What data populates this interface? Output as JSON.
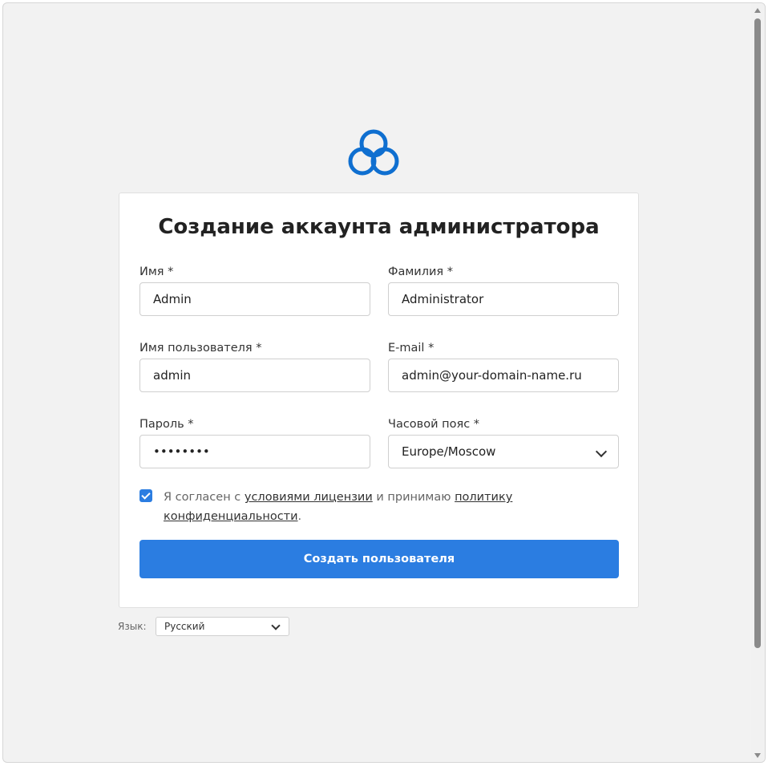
{
  "logo": {
    "icon": "cloud-logo-icon",
    "color": "#0f6fd0"
  },
  "card": {
    "title": "Создание аккаунта администратора",
    "fields": {
      "first_name": {
        "label": "Имя *",
        "value": "Admin"
      },
      "last_name": {
        "label": "Фамилия *",
        "value": "Administrator"
      },
      "username": {
        "label": "Имя пользователя *",
        "value": "admin"
      },
      "email": {
        "label": "E-mail *",
        "value": "admin@your-domain-name.ru"
      },
      "password": {
        "label": "Пароль *",
        "value": "••••••••"
      },
      "timezone": {
        "label": "Часовой пояс *",
        "value": "Europe/Moscow"
      }
    },
    "agree": {
      "checked": true,
      "text_before": "Я согласен с ",
      "license_link": "условиями лицензии",
      "text_middle": " и принимаю ",
      "privacy_link": "политику конфиденциальности",
      "text_after": "."
    },
    "submit_label": "Создать пользователя"
  },
  "language": {
    "label": "Язык:",
    "value": "Русский"
  },
  "colors": {
    "accent": "#2b7de1",
    "page_bg": "#f2f2f2"
  }
}
